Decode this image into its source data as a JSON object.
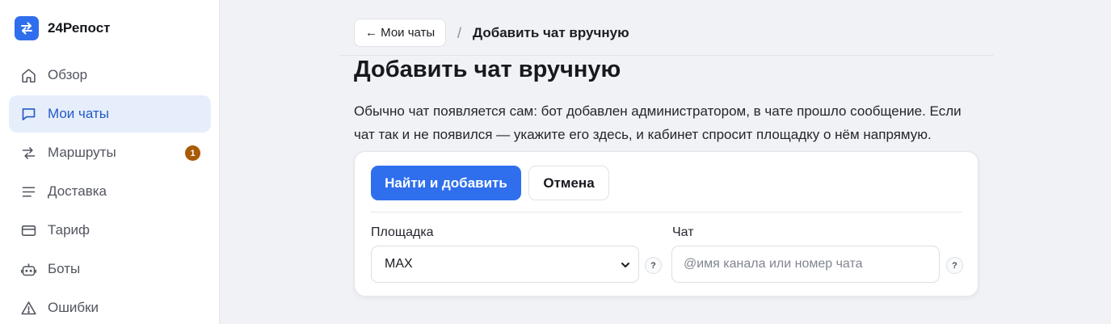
{
  "app": {
    "name": "24Репост",
    "logo_icon": "swap-arrows-icon",
    "accent": "#2f6fed"
  },
  "sidebar": {
    "items": [
      {
        "label": "Обзор",
        "icon": "home-icon",
        "active": false
      },
      {
        "label": "Мои чаты",
        "icon": "chat-icon",
        "active": true
      },
      {
        "label": "Маршруты",
        "icon": "route-icon",
        "active": false,
        "badge": "1"
      },
      {
        "label": "Доставка",
        "icon": "list-icon",
        "active": false
      },
      {
        "label": "Тариф",
        "icon": "card-icon",
        "active": false
      },
      {
        "label": "Боты",
        "icon": "bot-icon",
        "active": false
      },
      {
        "label": "Ошибки",
        "icon": "warning-icon",
        "active": false
      }
    ]
  },
  "breadcrumb": {
    "back_label": "← Мои чаты",
    "separator": "/",
    "current": "Добавить чат вручную"
  },
  "page": {
    "title": "Добавить чат вручную",
    "intro_line1": "Обычно чат появляется сам: бот добавлен администратором, в чате прошло сообщение. Если",
    "intro_line2": "чат так и не появился — укажите его здесь, и кабинет спросит площадку о нём напрямую."
  },
  "form": {
    "submit_label": "Найти и добавить",
    "cancel_label": "Отмена",
    "platform_label": "Площадка",
    "platform_value": "MAX",
    "chat_label": "Чат",
    "chat_placeholder": "@имя канала или номер чата",
    "chat_value": "",
    "help_glyph": "?"
  }
}
